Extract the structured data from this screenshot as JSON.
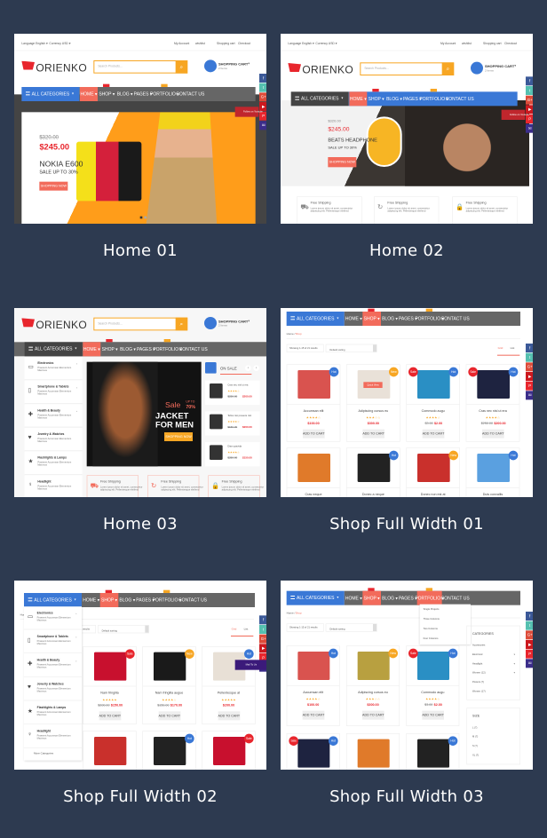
{
  "colors": {
    "background": "#2d3a50",
    "blue": "#3a78d6",
    "salmon": "#f26b5b",
    "grey": "#666666",
    "dark": "#444444",
    "orange": "#f7a623",
    "red": "#e8262d"
  },
  "site": {
    "language": "Language English ▾",
    "currency": "Currency USD ▾",
    "links": [
      "My Account",
      "wishlist",
      "Shopping cart",
      "Checkout"
    ],
    "logo": "ORIENKO",
    "search_placeholder": "Search Products...",
    "cart_title": "SHOPPING CART",
    "cart_count": "2 Items",
    "categories": "ALL CATEGORIES",
    "menu": [
      "HOME ▾",
      "SHOP ▾",
      "BLOG ▾",
      "PAGES ▾",
      "PORTFOLIO ▾",
      "CONTACT US"
    ],
    "social": [
      "facebook-icon",
      "twitter-icon",
      "google-plus-icon",
      "youtube-icon",
      "pinterest-icon",
      "mail-icon"
    ],
    "youtube_tip": "Follow on Youtube",
    "mail_tip": "Mail To Us",
    "cat_list": [
      {
        "name": "Electronics",
        "desc": "Praesent Accumsan Elementum Maximus"
      },
      {
        "name": "Smartphone & Tablets",
        "desc": "Praesent Accumsan Elementum Maximus"
      },
      {
        "name": "Health & Beauty",
        "desc": "Praesent Accumsan Elementum Maximus"
      },
      {
        "name": "Jewelry & Watches",
        "desc": "Praesent Accumsan Elementum Maximus"
      },
      {
        "name": "Flashlights & Lamps",
        "desc": "Praesent Accumsan Elementum Maximus"
      },
      {
        "name": "Headlight",
        "desc": "Praesent Accumsan Elementum Maximus"
      }
    ],
    "more_categories": "More Categories",
    "feature_title": "Free Shipping",
    "feature_text": "Lorem ipsum dolor sit amet, consectetur adipiscing elit. Pellentesque eleifend",
    "breadcrumb_home": "Home /",
    "breadcrumb_shop": "Shop",
    "showing": "Showing 1-15 of 21 results",
    "sorting": "Default sorting",
    "grid": "Grid",
    "list": "List",
    "add_to_cart": "ADD TO CART",
    "quick_view": "Quick View"
  },
  "home01": {
    "old_price": "$320.00",
    "price": "$245.00",
    "title": "NOKIA E600",
    "sub": "SALE UP TO 30%",
    "button": "SHOPPING NOW"
  },
  "home02": {
    "old_price": "$320.00",
    "price": "$245.00",
    "title": "BEATS HEADPHONE",
    "sub": "SALE UP TO 30%",
    "button": "SHOPPING NOW"
  },
  "home03": {
    "sale": "Sale",
    "upto": "UP TO",
    "pct": "70%",
    "line1": "JACKET",
    "line2": "FOR MEN",
    "button": "SHOPPING NOW",
    "on_sale": "ON SALE",
    "sale_items": [
      {
        "name": "Cras nec nisl ut era",
        "rating": 4,
        "old": "$250.00",
        "price": "$200.00"
      },
      {
        "name": "Tellus nisi posuere nisl",
        "rating": 4,
        "old": "$150.00",
        "price": "$200.00"
      },
      {
        "name": "Diam gravida",
        "rating": 4,
        "old": "$250.00",
        "price": "$150.00"
      }
    ]
  },
  "shop01": {
    "products": [
      {
        "name": "Accumsan elit",
        "rating": 4,
        "old": "",
        "price": "$100.00",
        "badges": [
          "Hot"
        ],
        "color": "#d9534f"
      },
      {
        "name": "Adipiscing cursus eu",
        "rating": 3,
        "old": "",
        "price": "$300.00",
        "badges": [
          "New"
        ],
        "color": "#e9e1d8"
      },
      {
        "name": "Commodo augu",
        "rating": 4,
        "old": "$3.00",
        "price": "$2.00",
        "badges": [
          "Sale",
          "Hot"
        ],
        "color": "#2a8fc4"
      },
      {
        "name": "Cras nec nisl ut era",
        "rating": 4,
        "old": "$250.00",
        "price": "$200.00",
        "badges": [
          "Sale",
          "Hot"
        ],
        "color": "#1e2340"
      },
      {
        "name": "Cras neque",
        "rating": 0,
        "old": "",
        "price": "",
        "badges": [],
        "color": "#e07a2a"
      },
      {
        "name": "Donec a neque",
        "rating": 0,
        "old": "",
        "price": "",
        "badges": [
          "Hot"
        ],
        "color": "#222222"
      },
      {
        "name": "Donec non est at",
        "rating": 0,
        "old": "",
        "price": "",
        "badges": [
          "New"
        ],
        "color": "#c9302c"
      },
      {
        "name": "Duis convallis",
        "rating": 0,
        "old": "",
        "price": "",
        "badges": [
          "Hot"
        ],
        "color": "#5aa0e0"
      }
    ]
  },
  "shop02": {
    "products": [
      {
        "name": "Nam fringilla",
        "rating": 5,
        "old": "$200.00",
        "price": "$150.00",
        "badges": [
          "Sale"
        ],
        "color": "#c8102e"
      },
      {
        "name": "Nam fringilla augue",
        "rating": 4,
        "old": "$150.00",
        "price": "$170.00",
        "badges": [
          "New"
        ],
        "color": "#1a1a1a"
      },
      {
        "name": "Pellentesque at",
        "rating": 5,
        "old": "",
        "price": "$200.00",
        "badges": [
          "Hot"
        ],
        "color": "#e8e0d6"
      },
      {
        "name": "",
        "rating": 0,
        "old": "",
        "price": "",
        "badges": [],
        "color": "#c9302c"
      },
      {
        "name": "",
        "rating": 0,
        "old": "",
        "price": "",
        "badges": [
          "Hot"
        ],
        "color": "#222222"
      },
      {
        "name": "",
        "rating": 0,
        "old": "",
        "price": "",
        "badges": [
          "Sale"
        ],
        "color": "#c8102e"
      }
    ]
  },
  "shop03": {
    "dropdown": [
      "Single Projects",
      "Three Columns",
      "Two Columns",
      "Four Columns"
    ],
    "categories_title": "CATEGORIES",
    "categories": [
      "Accessories",
      "Electronic",
      "Headlight",
      "Women (12)",
      "Posters (7)",
      "Women (17)"
    ],
    "size_title": "SIZE",
    "sizes": [
      "L (7)",
      "M (7)",
      "S (7)",
      "XL (7)"
    ],
    "products": [
      {
        "name": "Accumsan elit",
        "rating": 4,
        "old": "",
        "price": "$100.00",
        "badges": [
          "Hot"
        ],
        "color": "#d9534f"
      },
      {
        "name": "Adipiscing cursus eu",
        "rating": 3,
        "old": "",
        "price": "$300.00",
        "badges": [
          "New"
        ],
        "color": "#b8a040"
      },
      {
        "name": "Commodo augu",
        "rating": 4,
        "old": "$3.00",
        "price": "$2.00",
        "badges": [
          "Sale",
          "Hot"
        ],
        "color": "#2a8fc4"
      },
      {
        "name": "",
        "rating": 0,
        "old": "",
        "price": "",
        "badges": [
          "Sale",
          "Hot"
        ],
        "color": "#1e2340"
      },
      {
        "name": "",
        "rating": 0,
        "old": "",
        "price": "",
        "badges": [],
        "color": "#e07a2a"
      },
      {
        "name": "",
        "rating": 0,
        "old": "",
        "price": "",
        "badges": [
          "Hot"
        ],
        "color": "#222222"
      }
    ]
  },
  "labels": [
    "Home 01",
    "Home 02",
    "Home 03",
    "Shop Full Width 01",
    "Shop Full Width 02",
    "Shop Full Width 03"
  ]
}
